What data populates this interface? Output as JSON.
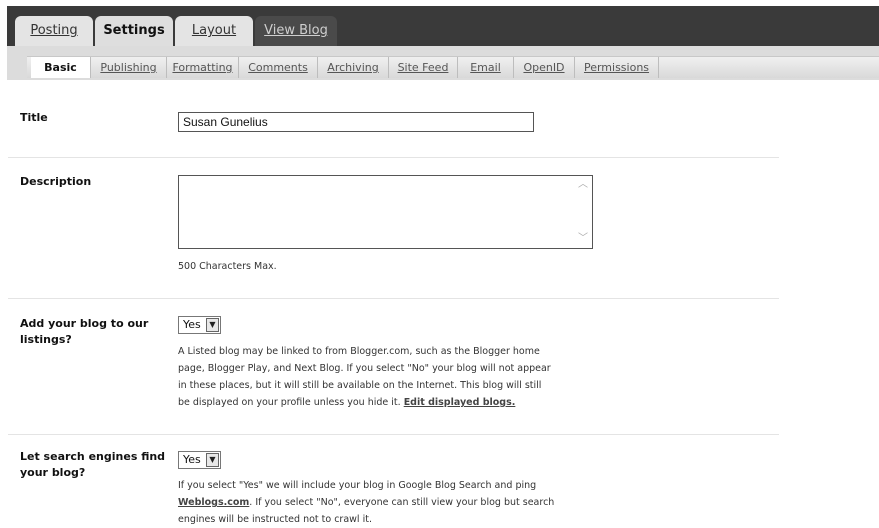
{
  "top_tabs": [
    {
      "label": "Posting",
      "state": "inactive"
    },
    {
      "label": "Settings",
      "state": "active"
    },
    {
      "label": "Layout",
      "state": "inactive"
    },
    {
      "label": "View Blog",
      "state": "dark"
    }
  ],
  "sub_tabs": [
    {
      "label": "Basic",
      "active": true
    },
    {
      "label": "Publishing",
      "active": false
    },
    {
      "label": "Formatting",
      "active": false
    },
    {
      "label": "Comments",
      "active": false
    },
    {
      "label": "Archiving",
      "active": false
    },
    {
      "label": "Site Feed",
      "active": false
    },
    {
      "label": "Email",
      "active": false
    },
    {
      "label": "OpenID",
      "active": false
    },
    {
      "label": "Permissions",
      "active": false
    }
  ],
  "form": {
    "title": {
      "label": "Title",
      "value": "Susan Gunelius"
    },
    "description": {
      "label": "Description",
      "value": "",
      "hint": "500 Characters Max."
    },
    "listings": {
      "label_line1": "Add your blog to our",
      "label_line2": "listings?",
      "value": "Yes",
      "desc_line1": "A Listed blog may be linked to from Blogger.com, such as the Blogger home",
      "desc_line2": "page, Blogger Play, and Next Blog. If you select \"No\" your blog will not appear",
      "desc_line3": "in these places, but it will still be available on the Internet. This blog will still",
      "desc_line4_prefix": "be displayed on your profile unless you hide it.",
      "desc_link": "Edit displayed blogs."
    },
    "search": {
      "label_line1": "Let search engines find",
      "label_line2": "your blog?",
      "value": "Yes",
      "desc_line1_prefix": "If you select \"Yes\" we will include your blog in Google Blog Search and ping",
      "desc_link": "Weblogs.com",
      "desc_line2_suffix": ". If you select \"No\", everyone can still view your blog but search",
      "desc_line3": "engines will be instructed not to crawl it."
    }
  },
  "colors": {
    "topbar": "#3a3a3a",
    "subbar": "#dcdcdc",
    "divider": "#e4e4e4"
  }
}
